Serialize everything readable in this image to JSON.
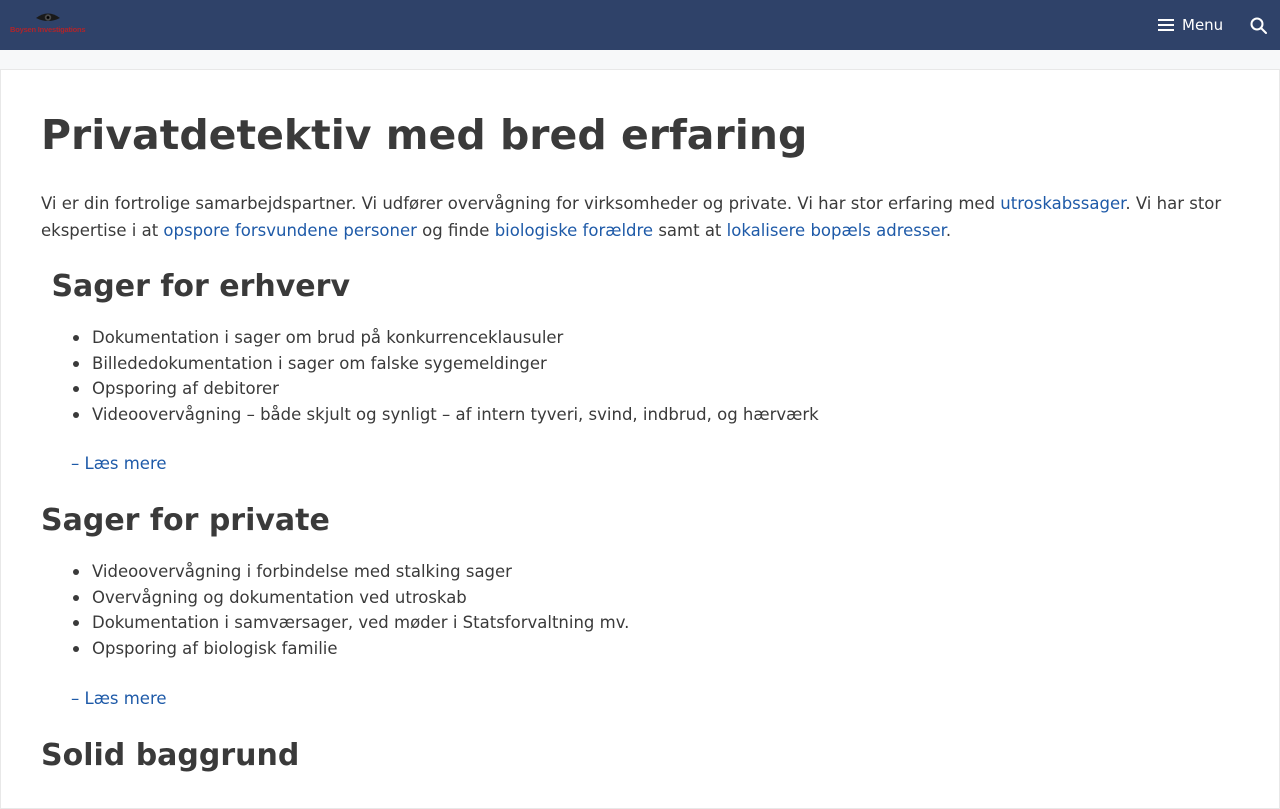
{
  "header": {
    "logo_text": "Boysen Investigations",
    "menu_label": "Menu",
    "menu_icon": "hamburger-icon",
    "search_icon": "search-icon"
  },
  "main": {
    "title": "Privatdetektiv med bred erfaring",
    "intro": {
      "t1": "Vi er din fortrolige samarbejdspartner. Vi udfører overvågning for virksomheder og private. Vi har stor erfaring med ",
      "link1": "utroskabssager",
      "t2": ". Vi har stor ekspertise i at ",
      "link2": "opspore forsvundene personer",
      "t3": " og finde ",
      "link3": "biologiske forældre",
      "t4": " samt at ",
      "link4": "lokalisere bopæls adresser",
      "t5": "."
    },
    "sections": [
      {
        "heading": " Sager for erhverv",
        "items": [
          "Dokumentation i sager om brud på konkurrenceklausuler",
          "Billededokumentation i sager om falske sygemeldinger",
          "Opsporing af debitorer",
          "Videoovervågning – både skjult og synligt – af intern tyveri, svind, indbrud, og hærværk"
        ],
        "read_more": "– Læs mere"
      },
      {
        "heading": "Sager for private",
        "items": [
          "Videoovervågning i forbindelse med stalking sager",
          "Overvågning og dokumentation ved utroskab",
          "Dokumentation i samværsager, ved møder i Statsforvaltning mv.",
          "Opsporing af biologisk familie"
        ],
        "read_more": "– Læs mere"
      },
      {
        "heading": "Solid baggrund"
      }
    ]
  },
  "colors": {
    "header_bg": "#2f4269",
    "link": "#1e5aa8",
    "text": "#3a3a3a",
    "logo_text": "#b0242a"
  }
}
